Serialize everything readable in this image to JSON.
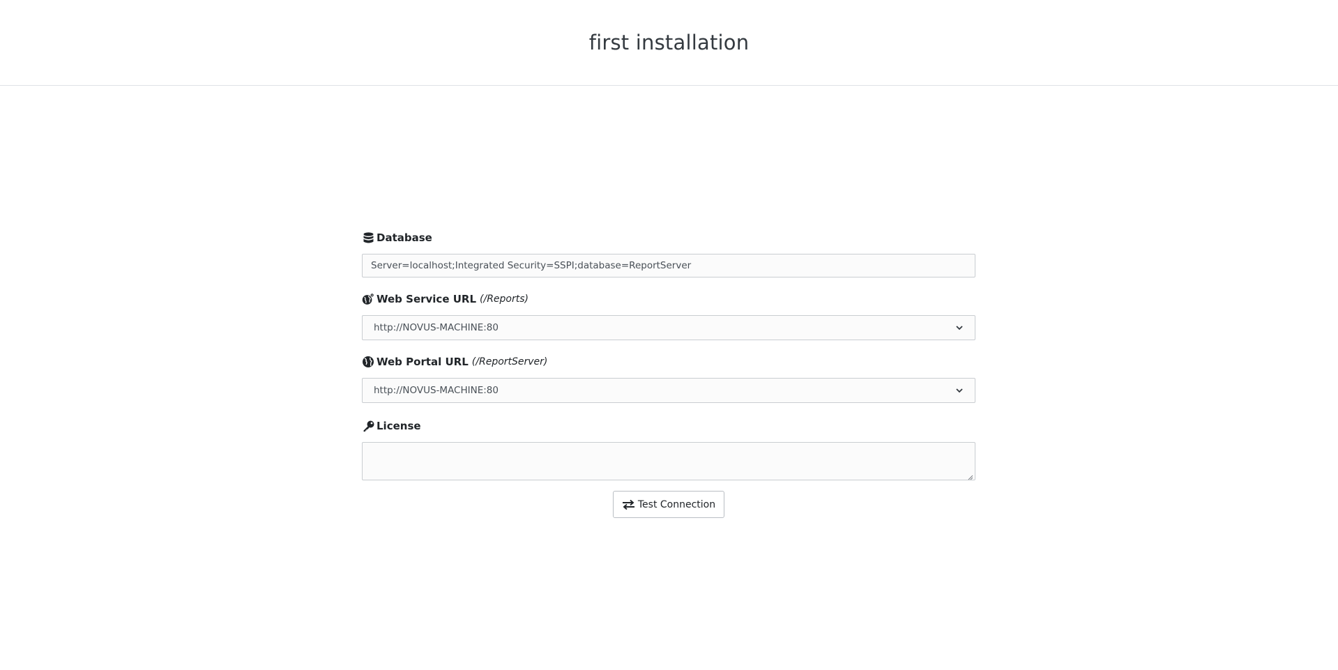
{
  "header": {
    "title": "first installation"
  },
  "form": {
    "database": {
      "icon": "database-icon",
      "label": "Database",
      "value": "Server=localhost;Integrated Security=SSPI;database=ReportServer"
    },
    "web_service": {
      "icon": "globe-gear-icon",
      "label": "Web Service URL",
      "hint": "(/Reports)",
      "selected": "http://NOVUS-MACHINE:80"
    },
    "web_portal": {
      "icon": "globe-icon",
      "label": "Web Portal URL",
      "hint": "(/ReportServer)",
      "selected": "http://NOVUS-MACHINE:80"
    },
    "license": {
      "icon": "key-icon",
      "label": "License",
      "value": ""
    },
    "test_button": {
      "icon": "exchange-arrows-icon",
      "label": "Test Connection"
    }
  }
}
